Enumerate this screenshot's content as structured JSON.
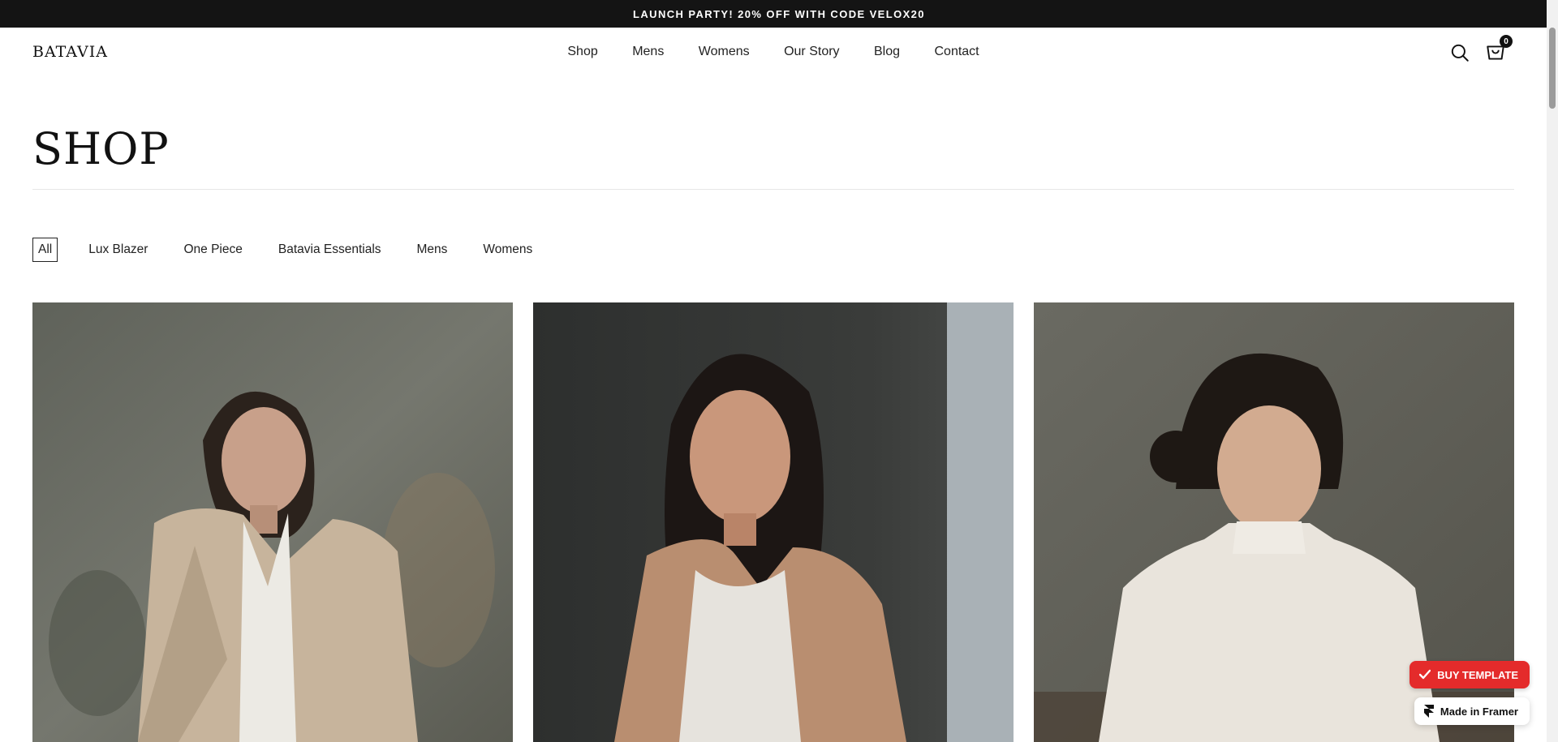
{
  "announcement": "LAUNCH PARTY! 20% OFF WITH CODE VELOX20",
  "header": {
    "logo": "BATAVIA",
    "nav": [
      "Shop",
      "Mens",
      "Womens",
      "Our Story",
      "Blog",
      "Contact"
    ],
    "cart_count": "0",
    "icons": [
      "search-icon",
      "cart-icon"
    ]
  },
  "page": {
    "title": "SHOP"
  },
  "filters": [
    "All",
    "Lux Blazer",
    "One Piece",
    "Batavia Essentials",
    "Mens",
    "Womens"
  ],
  "active_filter": "All",
  "products": [
    {
      "image": "woman in beige blazer and white shirt"
    },
    {
      "image": "woman in tan blazer and white tank top"
    },
    {
      "image": "woman in white pleated blouse"
    }
  ],
  "badges": {
    "buy_template": "BUY TEMPLATE",
    "made_in_framer": "Made in Framer"
  },
  "colors": {
    "announcement_bg": "#141414",
    "buy_button": "#e42b2b"
  }
}
